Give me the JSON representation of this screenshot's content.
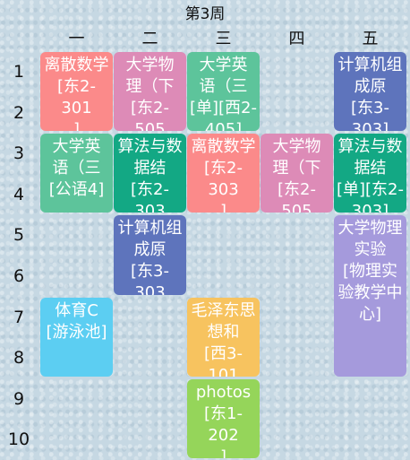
{
  "header": {
    "week_label": "第3周",
    "days": [
      "一",
      "二",
      "三",
      "四",
      "五"
    ]
  },
  "periods": [
    "1",
    "2",
    "3",
    "4",
    "5",
    "6",
    "7",
    "8",
    "9",
    "10"
  ],
  "colors": {
    "salmon": "#fb8a8a",
    "pink": "#dd8bb7",
    "mint": "#5dc49b",
    "teal": "#13a884",
    "navy": "#5e74bc",
    "sky": "#5ccef2",
    "orange": "#f7c35f",
    "green": "#95d55a",
    "lavender": "#a59adc"
  },
  "courses": [
    {
      "text": "离散数学\n[东2-301\n]",
      "day": 1,
      "start": 1,
      "span": 2,
      "color": "#fb8a8a"
    },
    {
      "text": "大学英\n语（三\n[公语4]",
      "day": 1,
      "start": 3,
      "span": 2,
      "color": "#5dc49b"
    },
    {
      "text": "体育C\n[游泳池]",
      "day": 1,
      "start": 7,
      "span": 2,
      "color": "#5ccef2"
    },
    {
      "text": "大学物\n理（下\n[东2-505\n]",
      "day": 2,
      "start": 1,
      "span": 2,
      "color": "#dd8bb7"
    },
    {
      "text": "算法与数\n据结\n[东2-303\n]",
      "day": 2,
      "start": 3,
      "span": 2,
      "color": "#13a884"
    },
    {
      "text": "计算机组\n成原\n[东3-303\n]",
      "day": 2,
      "start": 5,
      "span": 2,
      "color": "#5e74bc"
    },
    {
      "text": "大学英\n语（三\n[单][西2-\n405]",
      "day": 3,
      "start": 1,
      "span": 2,
      "color": "#5dc49b"
    },
    {
      "text": "离散数学\n[东2-303\n]",
      "day": 3,
      "start": 3,
      "span": 2,
      "color": "#fb8a8a"
    },
    {
      "text": "毛泽东思\n想和\n[西3-101\n]",
      "day": 3,
      "start": 7,
      "span": 2,
      "color": "#f7c35f"
    },
    {
      "text": "photos\n[东1-202\n]",
      "day": 3,
      "start": 9,
      "span": 2,
      "color": "#95d55a"
    },
    {
      "text": "大学物\n理（下\n[东2-505\n]",
      "day": 4,
      "start": 3,
      "span": 2,
      "color": "#dd8bb7"
    },
    {
      "text": "计算机组\n成原\n[东3-303]",
      "day": 5,
      "start": 1,
      "span": 2,
      "color": "#5e74bc"
    },
    {
      "text": "算法与数\n据结\n[单][东2-\n303]",
      "day": 5,
      "start": 3,
      "span": 2,
      "color": "#13a884"
    },
    {
      "text": "大学物理\n实验\n[物理实\n验教学中\n心]",
      "day": 5,
      "start": 5,
      "span": 4,
      "color": "#a59adc"
    }
  ]
}
